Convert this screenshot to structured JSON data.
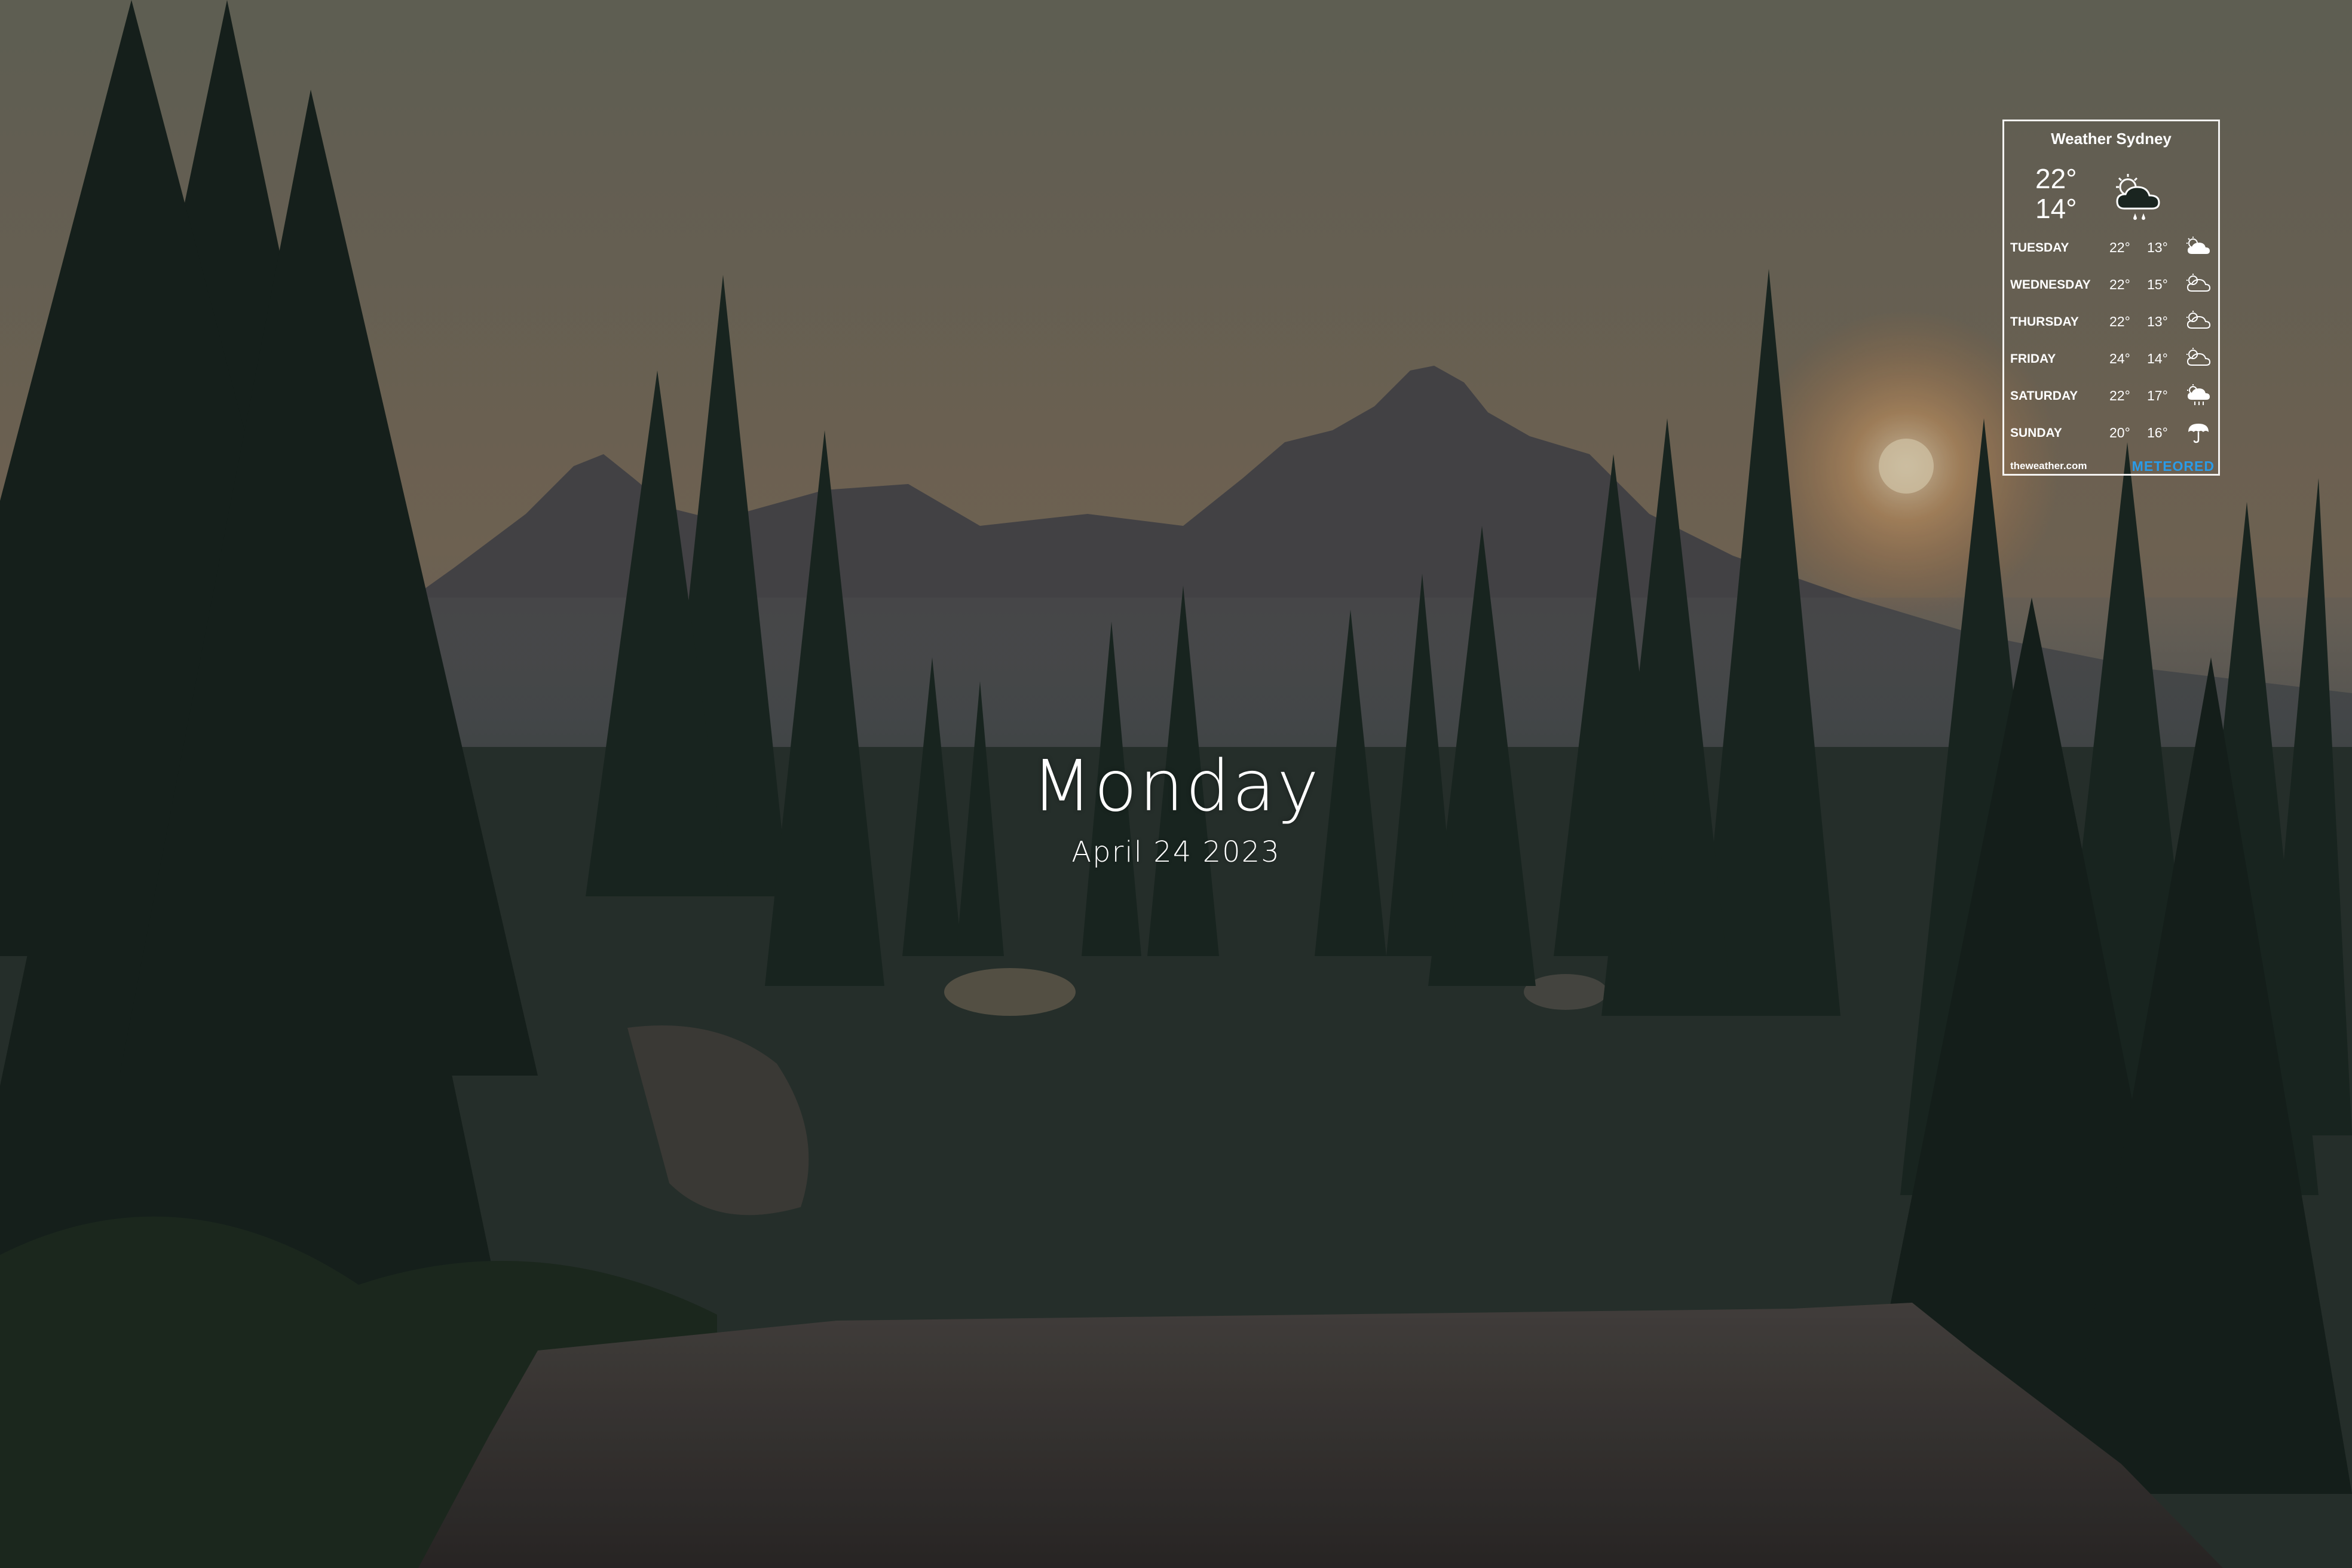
{
  "desktop": {
    "day_name": "Monday",
    "date": "April 24 2023"
  },
  "weather": {
    "title": "Weather Sydney",
    "today": {
      "high": "22°",
      "low": "14°",
      "icon": "cloud-sun-rain-icon"
    },
    "forecast": [
      {
        "day": "TUESDAY",
        "high": "22°",
        "low": "13°",
        "icon": "cloud-sun-icon"
      },
      {
        "day": "WEDNESDAY",
        "high": "22°",
        "low": "15°",
        "icon": "partly-cloudy-icon"
      },
      {
        "day": "THURSDAY",
        "high": "22°",
        "low": "13°",
        "icon": "partly-cloudy-icon"
      },
      {
        "day": "FRIDAY",
        "high": "24°",
        "low": "14°",
        "icon": "partly-cloudy-icon"
      },
      {
        "day": "SATURDAY",
        "high": "22°",
        "low": "17°",
        "icon": "cloud-rain-icon"
      },
      {
        "day": "SUNDAY",
        "high": "20°",
        "low": "16°",
        "icon": "umbrella-icon"
      }
    ],
    "source": "theweather.com",
    "brand": "METEORED",
    "brand_color": "#2a9be8"
  }
}
